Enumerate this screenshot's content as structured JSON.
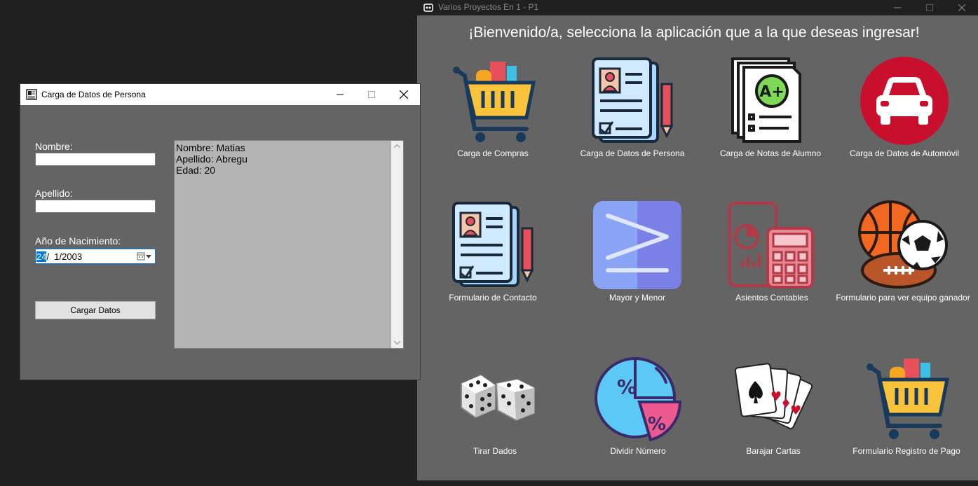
{
  "main_window": {
    "title": "Varios Proyectos En 1 - P1",
    "welcome": "¡Bienvenido/a, selecciona la aplicación que a la que deseas ingresar!",
    "apps": [
      {
        "label": "Carga de Compras",
        "icon": "shopping-cart-icon"
      },
      {
        "label": "Carga de Datos de Persona",
        "icon": "person-document-icon"
      },
      {
        "label": "Carga de Notas de Alumno",
        "icon": "grade-report-icon"
      },
      {
        "label": "Carga de Datos de Automóvil",
        "icon": "car-icon"
      },
      {
        "label": "Formulario de Contacto",
        "icon": "contact-document-icon"
      },
      {
        "label": "Mayor y Menor",
        "icon": "greater-equal-icon"
      },
      {
        "label": "Asientos Contables",
        "icon": "calculator-icon"
      },
      {
        "label": "Formulario para ver equipo ganador",
        "icon": "sports-balls-icon"
      },
      {
        "label": "Tirar Dados",
        "icon": "dice-icon"
      },
      {
        "label": "Dividir Número",
        "icon": "percent-pie-icon"
      },
      {
        "label": "Barajar Cartas",
        "icon": "playing-cards-icon"
      },
      {
        "label": "Formulario Registro de Pago",
        "icon": "payment-cart-icon"
      }
    ]
  },
  "form_window": {
    "title": "Carga de Datos de Persona",
    "nombre_label": "Nombre:",
    "nombre_value": "",
    "apellido_label": "Apellido:",
    "apellido_value": "",
    "nacimiento_label": "Año de Nacimiento:",
    "date_day": "24",
    "date_rest": "/  1/2003",
    "button_label": "Cargar Datos",
    "output_lines": [
      "Nombre: Matias",
      "Apellido: Abregu",
      "Edad: 20"
    ]
  },
  "colors": {
    "window_bg": "#646464",
    "desktop_bg": "#202020",
    "selection": "#0078d7",
    "car_red": "#c8102e"
  }
}
